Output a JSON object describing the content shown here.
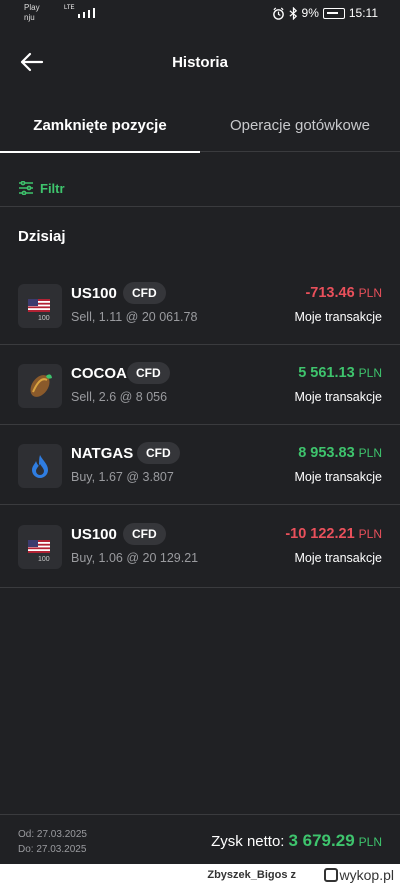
{
  "status_bar": {
    "carrier_line1": "Play",
    "carrier_line2": "nju",
    "network": "LTE",
    "battery_percent": "9%",
    "time": "15:11"
  },
  "header": {
    "title": "Historia"
  },
  "tabs": [
    {
      "label": "Zamknięte pozycje",
      "active": true
    },
    {
      "label": "Operacje gotówkowe",
      "active": false
    }
  ],
  "filter": {
    "label": "Filtr"
  },
  "section": {
    "label": "Dzisiaj"
  },
  "positions": [
    {
      "symbol": "US100",
      "type": "CFD",
      "details": "Sell, 1.11 @ 20 061.78",
      "amount": "-713.46",
      "currency": "PLN",
      "direction": "negative",
      "link": "Moje transakcje",
      "icon": "us-flag-icon"
    },
    {
      "symbol": "COCOA",
      "type": "CFD",
      "details": "Sell, 2.6 @ 8 056",
      "amount": "5 561.13",
      "currency": "PLN",
      "direction": "positive",
      "link": "Moje transakcje",
      "icon": "cocoa-icon"
    },
    {
      "symbol": "NATGAS",
      "type": "CFD",
      "details": "Buy, 1.67 @ 3.807",
      "amount": "8 953.83",
      "currency": "PLN",
      "direction": "positive",
      "link": "Moje transakcje",
      "icon": "gas-flame-icon"
    },
    {
      "symbol": "US100",
      "type": "CFD",
      "details": "Buy, 1.06 @ 20 129.21",
      "amount": "-10 122.21",
      "currency": "PLN",
      "direction": "negative",
      "link": "Moje transakcje",
      "icon": "us-flag-icon"
    }
  ],
  "index_tag": "100",
  "footer": {
    "from": "Od: 27.03.2025",
    "to": "Do: 27.03.2025",
    "net_label": "Zysk netto:",
    "net_value": "3 679.29",
    "net_currency": "PLN"
  },
  "watermark": {
    "user": "Zbyszek_Bigos  z",
    "site": "wykop.pl"
  },
  "colors": {
    "background": "#202124",
    "positive": "#3ec46d",
    "negative": "#e9505b"
  }
}
